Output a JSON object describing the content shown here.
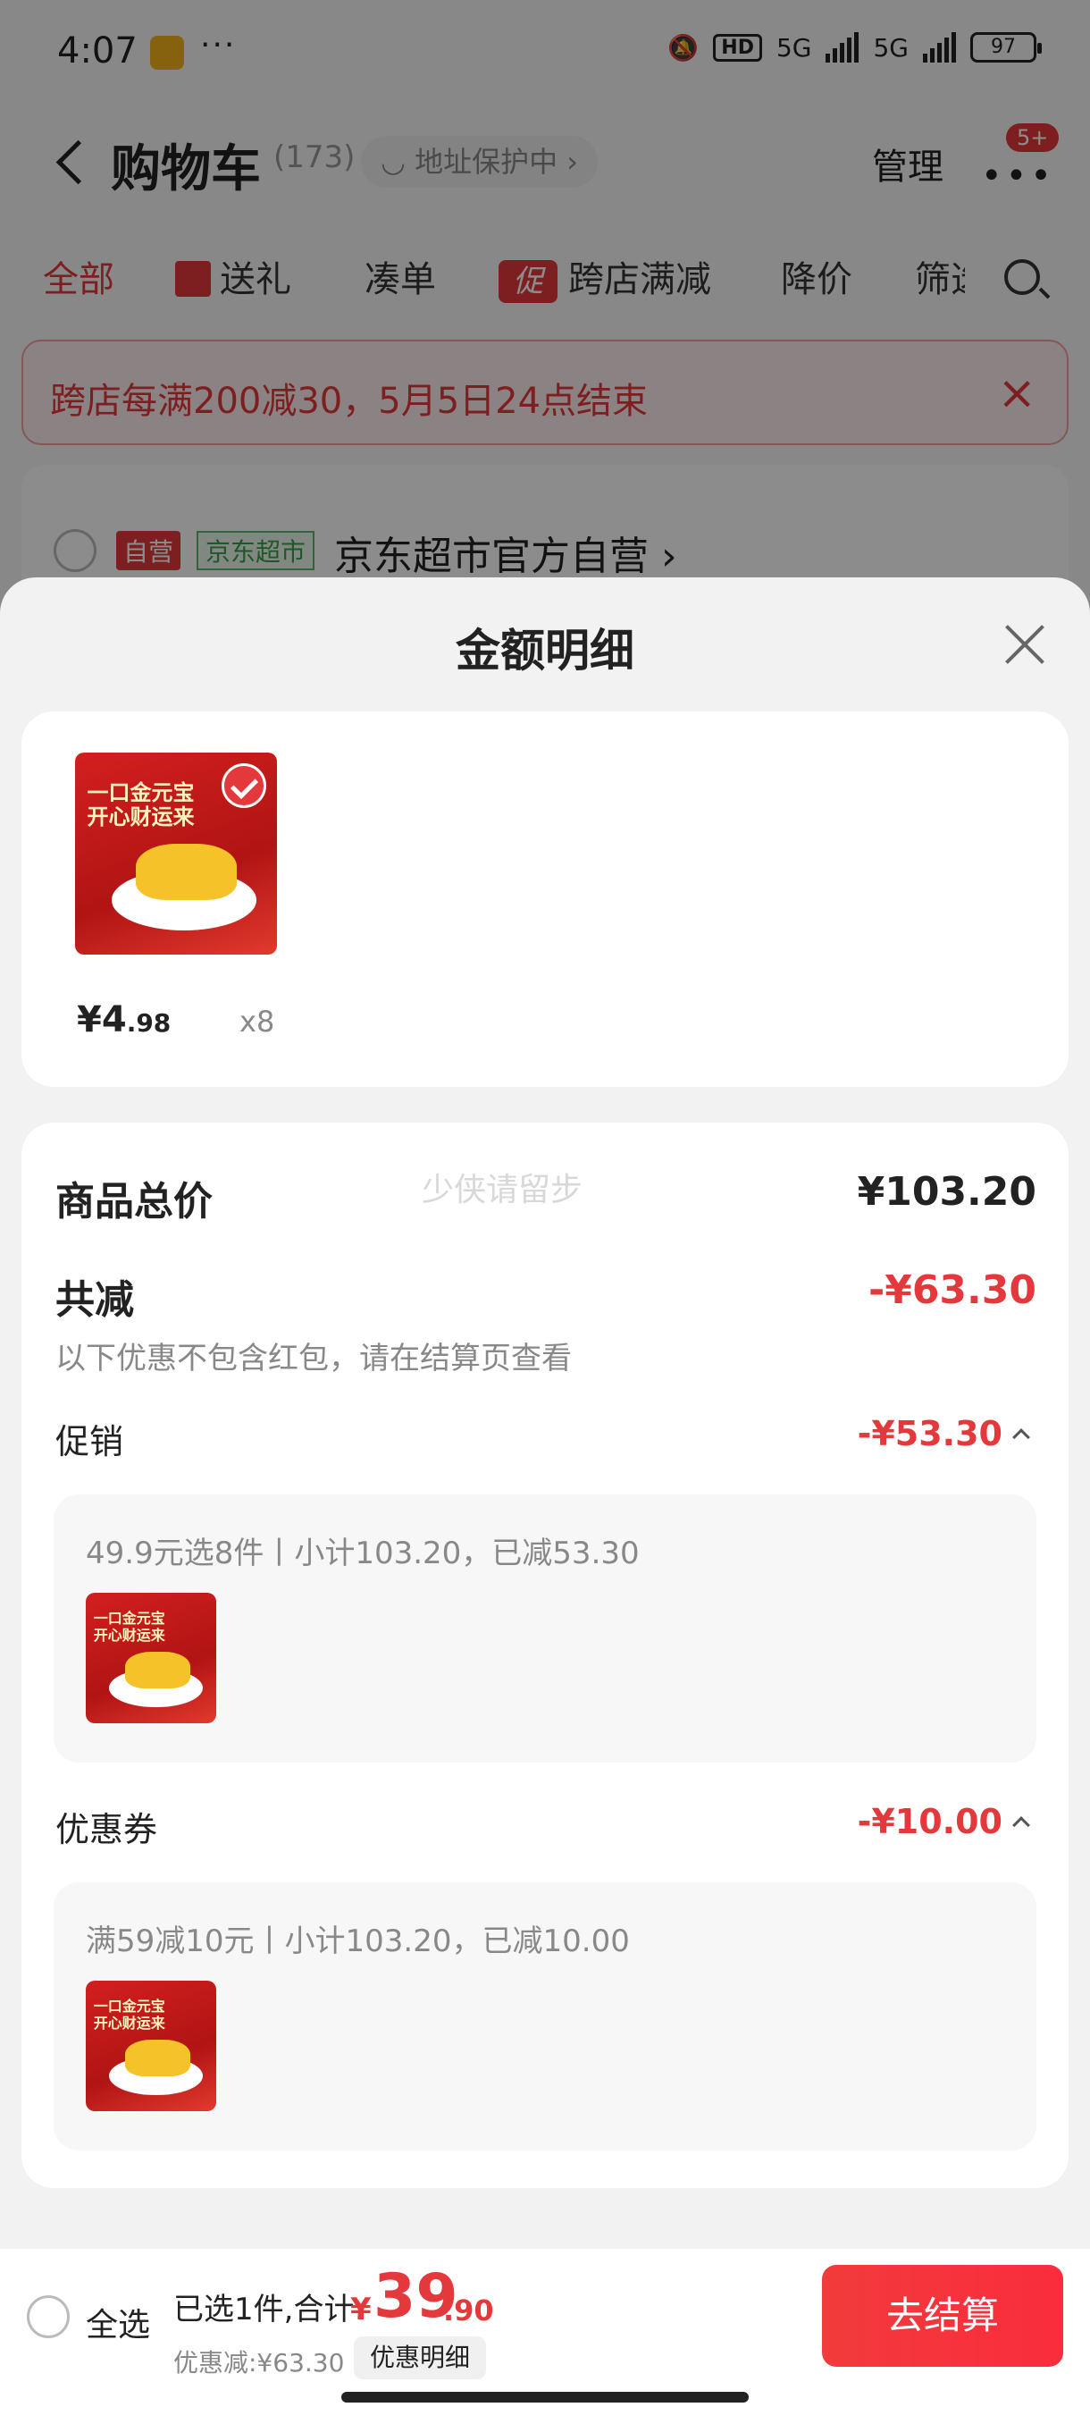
{
  "status_bar": {
    "time": "4:07",
    "dots": "···",
    "hd": "HD",
    "net1": "5G",
    "net2": "5G",
    "battery": "97"
  },
  "nav": {
    "title": "购物车",
    "count": "(173)",
    "address": "地址保护中",
    "manage": "管理",
    "badge": "5+"
  },
  "tabs": [
    {
      "label": "全部"
    },
    {
      "label": "送礼"
    },
    {
      "label": "凑单"
    },
    {
      "label": "跨店满减",
      "icon_text": "促"
    },
    {
      "label": "降价"
    },
    {
      "label": "筛选"
    }
  ],
  "banner": {
    "text": "跨店每满200减30，5月5日24点结束"
  },
  "store": {
    "self_tag": "自营",
    "jd_tag": "京东超市",
    "name": "京东超市官方自营"
  },
  "sheet": {
    "title": "金额明细"
  },
  "product": {
    "thumb_text_1": "一口金元宝",
    "thumb_text_2": "开心财运来",
    "price_symbol": "¥",
    "price_int": "4",
    "price_dec": ".98",
    "qty": "x8"
  },
  "summary": {
    "total_label": "商品总价",
    "total_value": "¥103.20",
    "reduce_label": "共减",
    "reduce_value": "-¥63.30",
    "note": "以下优惠不包含红包，请在结算页查看",
    "promo_label": "促销",
    "promo_value": "-¥53.30",
    "promo_detail": "49.9元选8件丨小计103.20，已减53.30",
    "coupon_label": "优惠券",
    "coupon_value": "-¥10.00",
    "coupon_detail": "满59减10元丨小计103.20，已减10.00"
  },
  "watermark": "少侠请留步",
  "bottom": {
    "select_all": "全选",
    "selected": "已选1件,合计:",
    "currency": "¥",
    "total_int": "39",
    "total_dec": ".90",
    "discount": "优惠减:¥63.30",
    "detail_button": "优惠明细",
    "checkout": "去结算"
  },
  "colors": {
    "accent": "#e4393c",
    "checkout": "#fa2c3d"
  }
}
